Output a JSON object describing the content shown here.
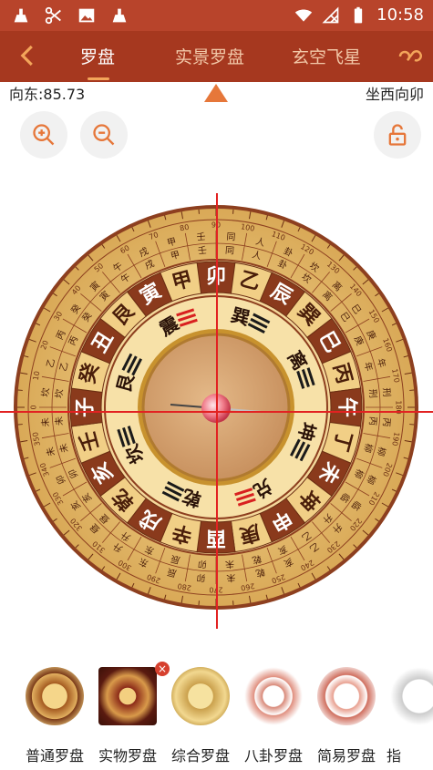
{
  "status_bar": {
    "time": "10:58"
  },
  "nav": {
    "tabs": [
      {
        "label": "罗盘"
      },
      {
        "label": "实景罗盘"
      },
      {
        "label": "玄空飞星"
      }
    ]
  },
  "heading": {
    "direction": "向东:85.73",
    "orientation": "坐西向卯"
  },
  "compass": {
    "degree_labels": [
      "0",
      "10",
      "20",
      "30",
      "40",
      "50",
      "60",
      "70",
      "80",
      "90",
      "100",
      "110",
      "120",
      "130",
      "140",
      "150",
      "160",
      "170",
      "180",
      "190",
      "200",
      "210",
      "220",
      "230",
      "240",
      "250",
      "260",
      "270",
      "280",
      "290",
      "300",
      "310",
      "320",
      "330",
      "340",
      "350"
    ],
    "mountains": [
      "卯",
      "乙",
      "辰",
      "巽",
      "巳",
      "丙",
      "午",
      "丁",
      "未",
      "坤",
      "申",
      "庚",
      "酉",
      "辛",
      "戌",
      "乾",
      "亥",
      "壬",
      "子",
      "癸",
      "丑",
      "艮",
      "寅",
      "甲"
    ],
    "inner_ring": [
      "震",
      "巽",
      "离",
      "坤",
      "兑",
      "乾",
      "坎",
      "艮"
    ],
    "outer_chars": [
      "同",
      "人",
      "卦",
      "坎",
      "离",
      "巳",
      "庚",
      "年",
      "刑",
      "丙",
      "柳",
      "柳",
      "临",
      "升",
      "乙",
      "亥",
      "乾",
      "未",
      "卯",
      "辰",
      "东",
      "升",
      "昼",
      "亥",
      "卯",
      "未",
      "未",
      "坎",
      "乙",
      "丙",
      "癸",
      "寅",
      "午",
      "戌",
      "甲",
      "壬"
    ]
  },
  "thumbnails": [
    {
      "label": "普通罗盘"
    },
    {
      "label": "实物罗盘"
    },
    {
      "label": "综合罗盘"
    },
    {
      "label": "八卦罗盘"
    },
    {
      "label": "简易罗盘"
    },
    {
      "label": "指"
    }
  ],
  "colors": {
    "header": "#a6381f",
    "status": "#b8442b",
    "accent": "#f3a55a",
    "crosshair": "#e22222",
    "pointer": "#e6773a"
  }
}
